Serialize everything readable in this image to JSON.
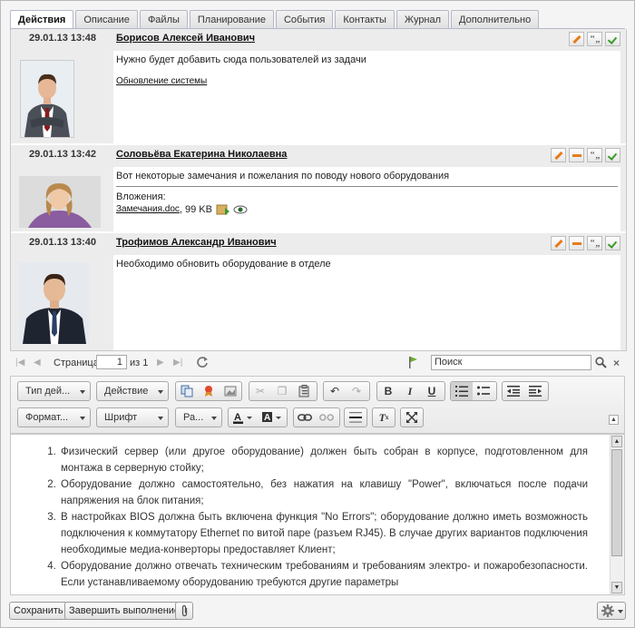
{
  "tabs": [
    "Действия",
    "Описание",
    "Файлы",
    "Планирование",
    "События",
    "Контакты",
    "Журнал",
    "Дополнительно"
  ],
  "entries": [
    {
      "date": "29.01.13 13:48",
      "author": "Борисов Алексей Иванович",
      "text": "Нужно будет добавить сюда пользователей из задачи",
      "link": "Обновление системы"
    },
    {
      "date": "29.01.13 13:42",
      "author": "Соловьёва Екатерина Николаевна",
      "text": "Вот некоторые замечания и пожелания по поводу нового оборудования",
      "attach_label": "Вложения:",
      "attach_file": "Замечания.doc",
      "attach_size": ", 99 KB"
    },
    {
      "date": "29.01.13 13:40",
      "author": "Трофимов Александр Иванович",
      "text": "Необходимо обновить оборудование в отделе"
    }
  ],
  "pager": {
    "page_label": "Страница",
    "page": "1",
    "of": "из 1",
    "search_placeholder": "Поиск"
  },
  "toolbar": {
    "type_dd": "Тип дей...",
    "action_dd": "Действие",
    "format_dd": "Формат...",
    "font_dd": "Шрифт",
    "size_dd": "Ра..."
  },
  "content": {
    "items": [
      "Физический сервер (или другое оборудование) должен быть собран в корпусе, подготовленном для монтажа в серверную стойку;",
      "Оборудование должно самостоятельно, без нажатия на клавишу \"Power\", включаться после подачи напряжения на блок питания;",
      "В настройках BIOS должна быть включена функция \"No Errors\"; оборудование должно иметь возможность подключения к коммутатору Ethernet по витой паре (разъем RJ45). В случае других вариантов подключения необходимые медиа-конверторы предоставляет Клиент;",
      "Оборудование должно отвечать техническим требованиям и требованиям электро- и пожаробезопасности. Если устанавливаемому оборудованию требуются другие параметры"
    ]
  },
  "bottom": {
    "save": "Сохранить",
    "finish": "Завершить выполнение"
  }
}
